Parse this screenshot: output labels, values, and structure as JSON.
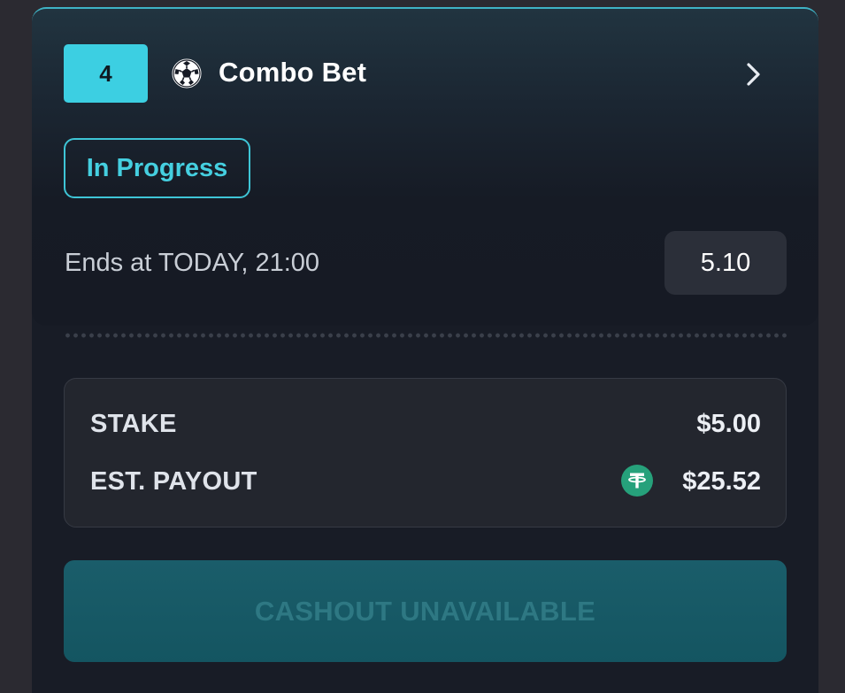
{
  "bet": {
    "selection_count": "4",
    "sport_icon": "soccer-ball-icon",
    "title": "Combo Bet",
    "status": "In Progress",
    "ends_at": "Ends at TODAY, 21:00",
    "odds": "5.10"
  },
  "summary": {
    "stake_label": "STAKE",
    "stake_value": "$5.00",
    "payout_label": "EST. PAYOUT",
    "payout_value": "$25.52",
    "currency_icon": "tether-usdt-icon"
  },
  "actions": {
    "cashout_label": "CASHOUT UNAVAILABLE"
  },
  "colors": {
    "accent": "#3ccfe2",
    "card_bg": "#161a24",
    "cashout_bg": "#145561",
    "tether_green": "#26a17b"
  }
}
